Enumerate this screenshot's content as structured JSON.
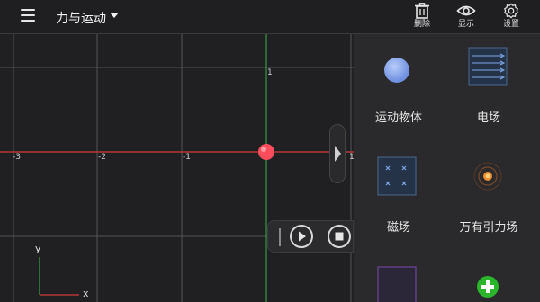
{
  "header": {
    "title": "力与运动",
    "tools": [
      {
        "label": "删除",
        "icon": "trash-icon"
      },
      {
        "label": "显示",
        "icon": "eye-icon"
      },
      {
        "label": "设置",
        "icon": "gear-icon"
      }
    ]
  },
  "grid": {
    "x_ticks": [
      "-3",
      "-2",
      "-1",
      "1"
    ],
    "y_ticks": [
      "1"
    ],
    "axis_x_label": "x",
    "axis_y_label": "y"
  },
  "palette": {
    "items": [
      {
        "label": "运动物体",
        "icon": "sphere-icon"
      },
      {
        "label": "电场",
        "icon": "electric-field-icon"
      },
      {
        "label": "磁场",
        "icon": "magnetic-field-icon"
      },
      {
        "label": "万有引力场",
        "icon": "gravity-field-icon"
      },
      {
        "label": "",
        "icon": "purple-field-icon"
      },
      {
        "label": "",
        "icon": "add-icon"
      }
    ]
  },
  "colors": {
    "x_axis": "#d23b3b",
    "y_axis": "#2e9b45",
    "object": "#ff4d5b",
    "accent_add": "#2bb52b"
  }
}
